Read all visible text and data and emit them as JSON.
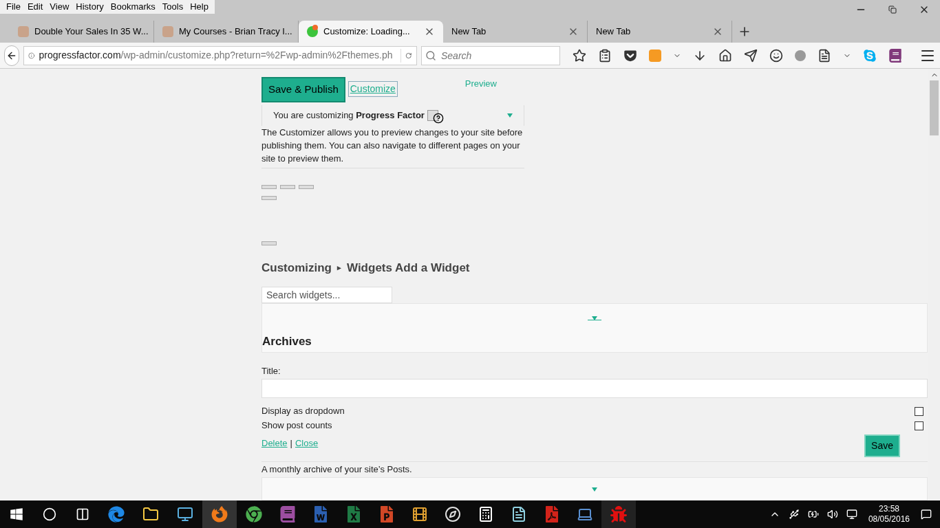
{
  "menu": [
    "File",
    "Edit",
    "View",
    "History",
    "Bookmarks",
    "Tools",
    "Help"
  ],
  "tabs": [
    {
      "title": "Double Your Sales In 35 W...",
      "selected": false,
      "kind": "person"
    },
    {
      "title": "My Courses - Brian Tracy I...",
      "selected": false,
      "kind": "person"
    },
    {
      "title": "Customize: Loading...",
      "selected": true,
      "kind": "site"
    },
    {
      "title": "New Tab",
      "selected": false,
      "kind": "blank"
    },
    {
      "title": "New Tab",
      "selected": false,
      "kind": "blank"
    }
  ],
  "address": {
    "host": "progressfactor.com",
    "path": "/wp-admin/customize.php?return=%2Fwp-admin%2Fthemes.ph"
  },
  "search": {
    "placeholder": "Search"
  },
  "customizer": {
    "save_publish": "Save & Publish",
    "customize_link": "Customize",
    "preview": "Preview",
    "notice": "You are customizing **Progress Factor**",
    "description": "The Customizer allows you to preview changes to your site before publishing them. You can also navigate to different pages on your site to preview them.",
    "breadcrumb": [
      "Customizing",
      "▸",
      "Widgets Add a Widget"
    ],
    "search_widgets": {
      "placeholder": "Search widgets..."
    },
    "widget": {
      "title": "Archives",
      "field_label": "Title:",
      "options": [
        {
          "label": "Display as dropdown",
          "checked": false
        },
        {
          "label": "Show post counts",
          "checked": false
        }
      ],
      "delete": "Delete",
      "separator": "|",
      "close": "Close",
      "save": "Save",
      "description": "A monthly archive of your site’s Posts."
    }
  },
  "clock": {
    "time": "23:58",
    "date": "08/05/2016"
  }
}
